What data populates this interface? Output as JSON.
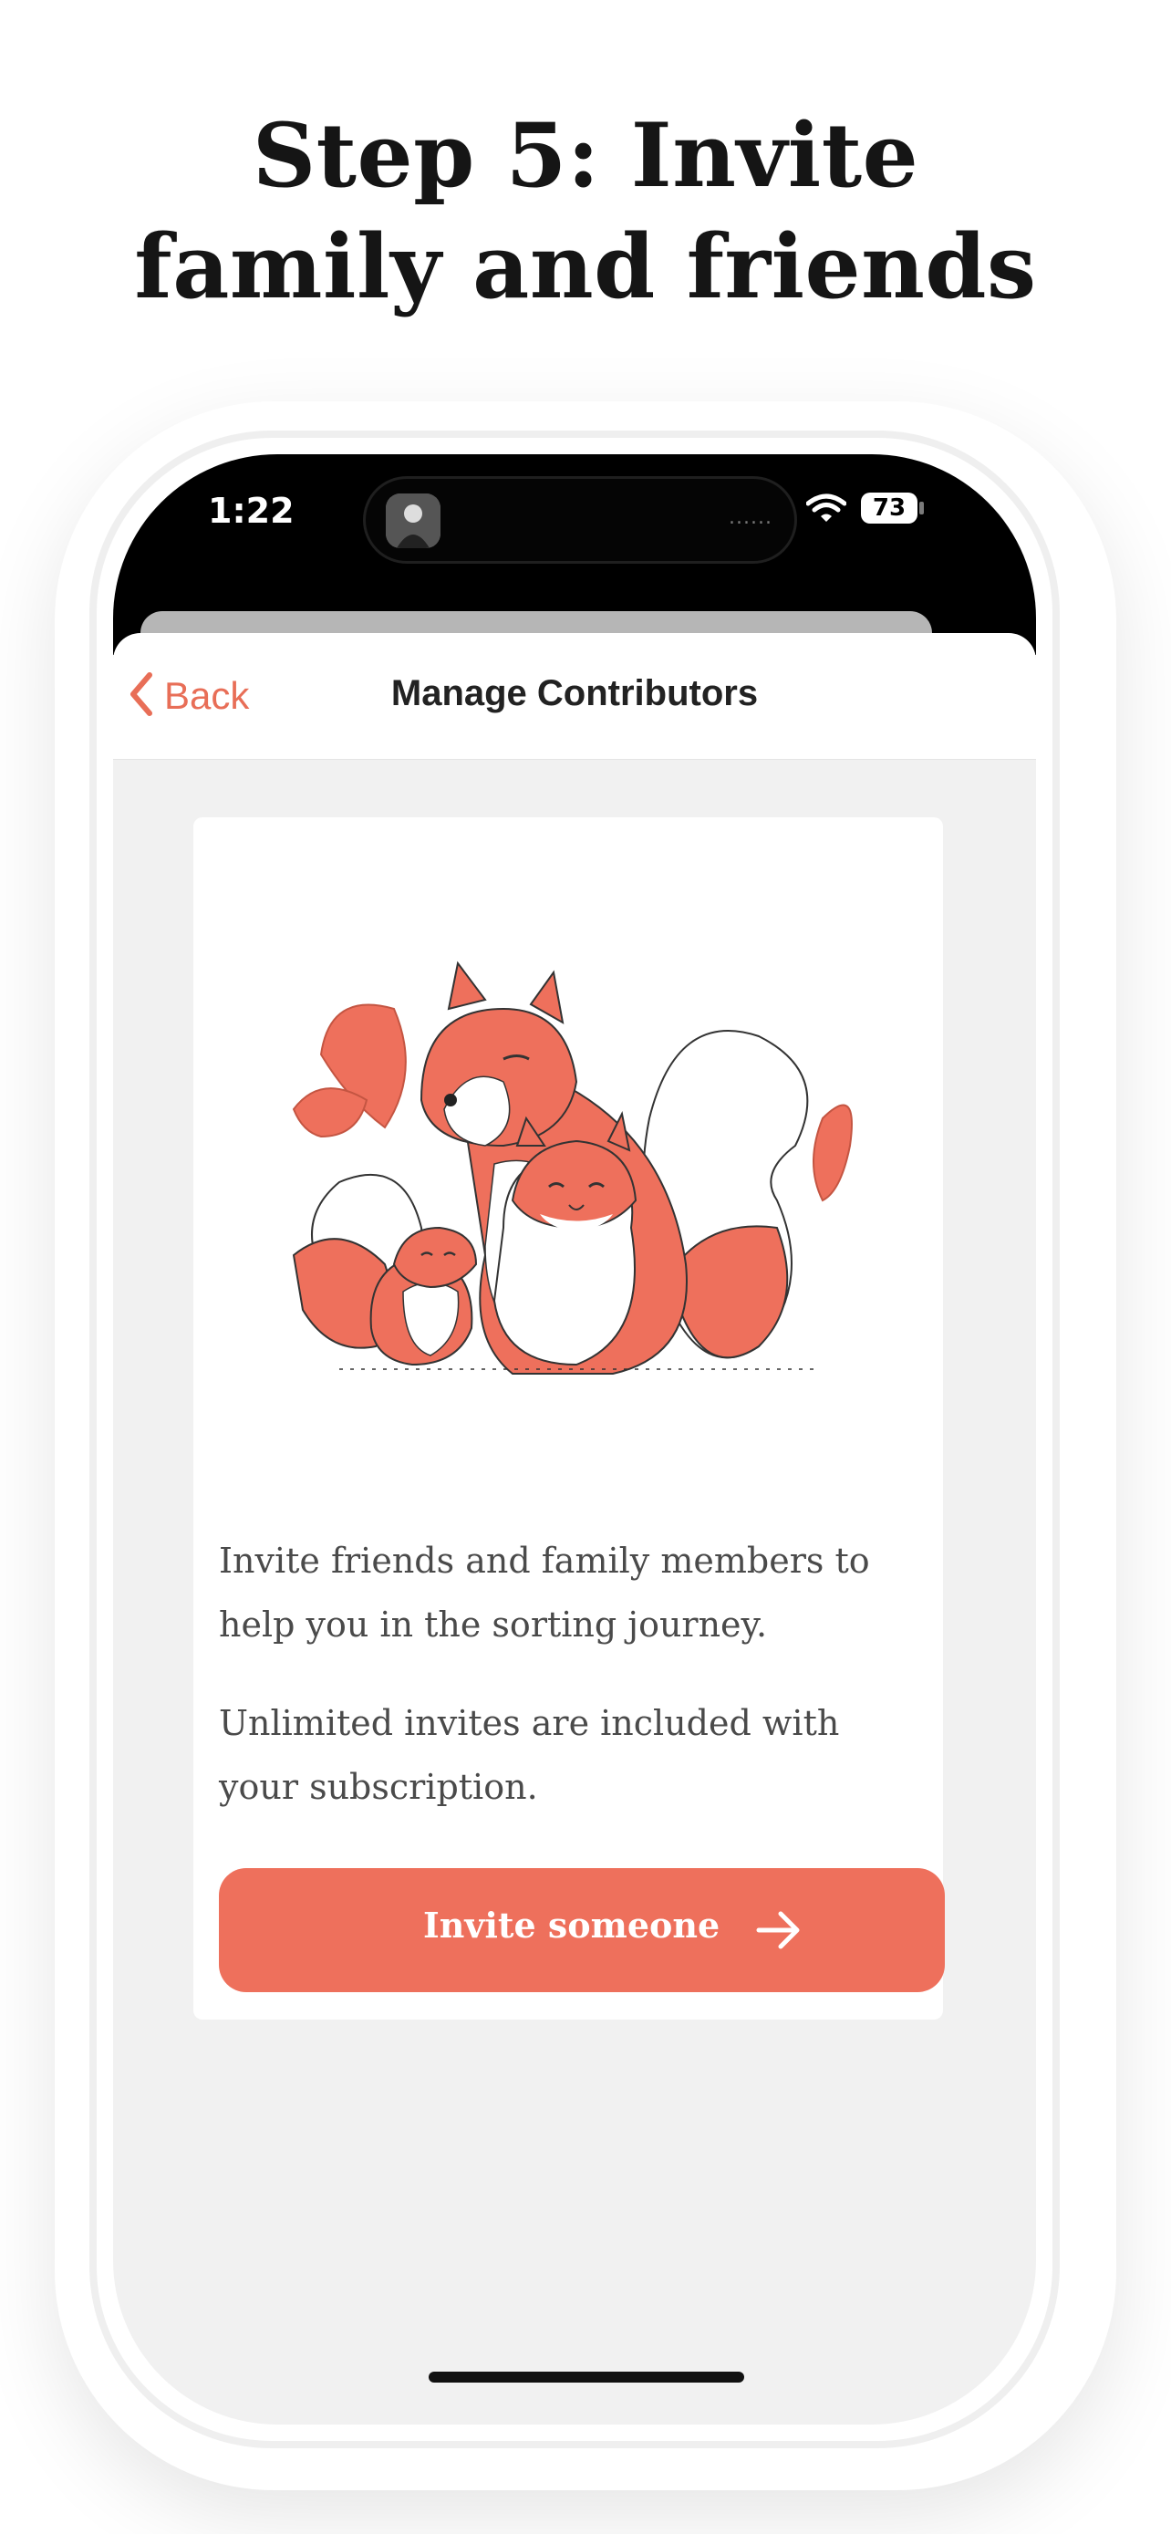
{
  "headline": {
    "line1": "Step 5: Invite",
    "line2": "family and friends"
  },
  "status_bar": {
    "time": "1:22",
    "battery": "73",
    "island_dots": "......"
  },
  "nav": {
    "back_label": "Back",
    "title": "Manage Contributors"
  },
  "card": {
    "paragraph1": "Invite friends and family members to help you in the sorting journey.",
    "paragraph2": "Unlimited invites are included with your subscription.",
    "button_label": "Invite someone",
    "button_icon": "arrow-right-icon",
    "illustration": "squirrel-family-illustration"
  },
  "colors": {
    "accent": "#ee705c",
    "background": "#f1f1f1",
    "text": "#4a4a4a"
  }
}
